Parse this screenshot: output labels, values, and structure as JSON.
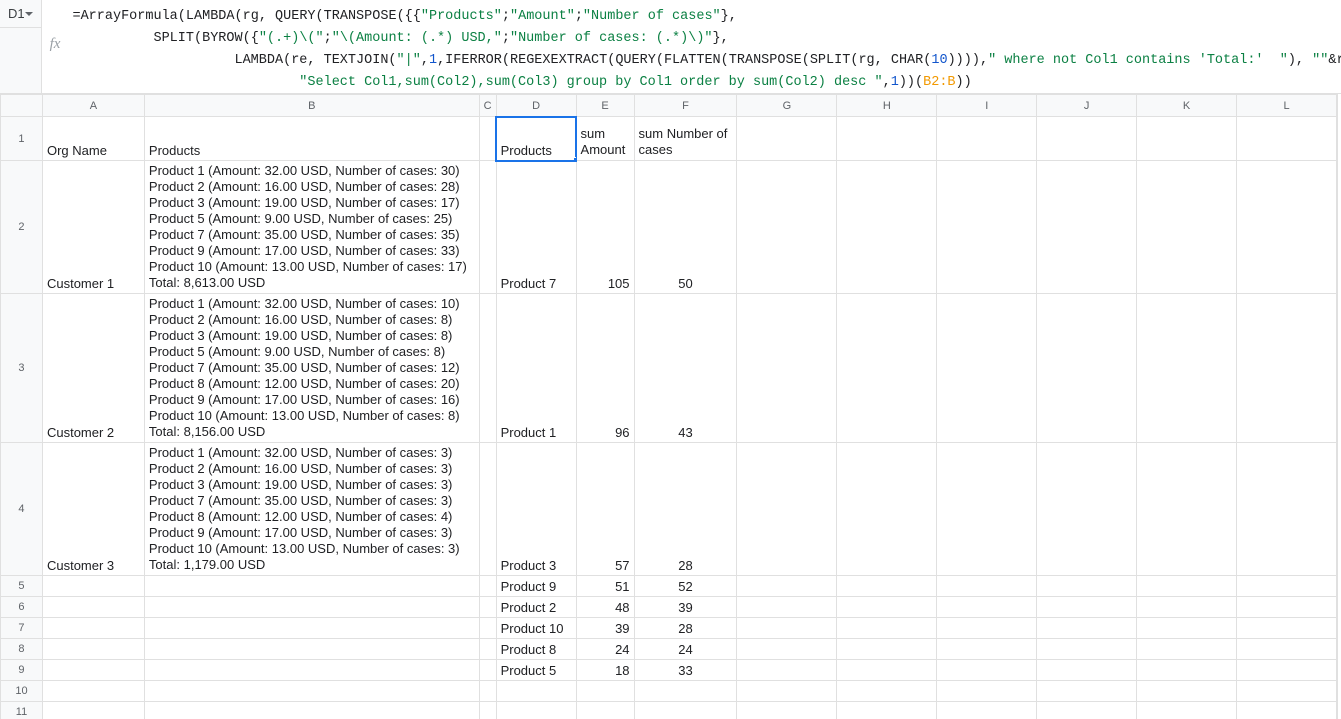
{
  "name_box": {
    "value": "D1"
  },
  "formula": {
    "line1_indent": "",
    "l1_eq": "=",
    "l1_af": "ArrayFormula",
    "l1_p1": "(",
    "l1_lambda": "LAMBDA",
    "l1_p2": "(",
    "l1_rg": "rg",
    "l1_c1": ", ",
    "l1_query": "QUERY",
    "l1_p3": "(",
    "l1_transpose": "TRANSPOSE",
    "l1_p4": "({{",
    "l1_s1": "\"Products\"",
    "l1_sc1": ";",
    "l1_s2": "\"Amount\"",
    "l1_sc2": ";",
    "l1_s3": "\"Number of cases\"",
    "l1_p5": "},",
    "line2_indent": "          ",
    "l2_split": "SPLIT",
    "l2_p1": "(",
    "l2_byrow": "BYROW",
    "l2_p2": "({",
    "l2_s1": "\"(.+)\\(\"",
    "l2_sc1": ";",
    "l2_s2": "\"\\(Amount: (.*) USD,\"",
    "l2_sc2": ";",
    "l2_s3": "\"Number of cases: (.*)\\)\"",
    "l2_p3": "},",
    "line3_indent": "                    ",
    "l3_lambda": "LAMBDA",
    "l3_p1": "(",
    "l3_re": "re",
    "l3_c1": ", ",
    "l3_tj": "TEXTJOIN",
    "l3_p2": "(",
    "l3_s1": "\"|\"",
    "l3_c2": ",",
    "l3_n1": "1",
    "l3_c3": ",",
    "l3_iferr": "IFERROR",
    "l3_p3": "(",
    "l3_regex": "REGEXEXTRACT",
    "l3_p4": "(",
    "l3_query": "QUERY",
    "l3_p5": "(",
    "l3_flat": "FLATTEN",
    "l3_p6": "(",
    "l3_trans": "TRANSPOSE",
    "l3_p7": "(",
    "l3_split": "SPLIT",
    "l3_p8": "(",
    "l3_rg": "rg",
    "l3_c4": ", ",
    "l3_char": "CHAR",
    "l3_p9": "(",
    "l3_n2": "10",
    "l3_p10": ")))),",
    "l3_s2": "\" where not Col1 contains 'Total:'  \"",
    "l3_c5": "), ",
    "l3_s3": "\"\"",
    "l3_amp1": "&",
    "l3_revar": "re",
    "l3_amp2": "&",
    "l3_s4": "\"\"",
    "l3_p11": "))))),",
    "l3_s5": "\"|\"",
    "l3_p12": ")}),",
    "line4_indent": "                            ",
    "l4_s1": "\"Select Col1,sum(Col2),sum(Col3) group by Col1 order by sum(Col2) desc \"",
    "l4_c1": ",",
    "l4_n1": "1",
    "l4_p1": "))(",
    "l4_ref": "B2:B",
    "l4_p2": "))"
  },
  "columns": [
    "A",
    "B",
    "C",
    "D",
    "E",
    "F",
    "G",
    "H",
    "I",
    "J",
    "K",
    "L"
  ],
  "headers": {
    "A": "Org Name",
    "B": "Products",
    "D": "Products",
    "E": "sum Amount",
    "F": "sum Number of cases"
  },
  "rows": [
    {
      "num": "2",
      "A": "Customer 1",
      "B": "Product 1 (Amount: 32.00 USD, Number of cases: 30)\nProduct 2 (Amount: 16.00 USD, Number of cases: 28)\nProduct 3 (Amount: 19.00 USD, Number of cases: 17)\nProduct 5 (Amount: 9.00 USD, Number of cases: 25)\nProduct 7 (Amount: 35.00 USD, Number of cases: 35)\nProduct 9 (Amount: 17.00 USD, Number of cases: 33)\nProduct 10 (Amount: 13.00 USD, Number of cases: 17)\nTotal: 8,613.00 USD",
      "D": "Product 7",
      "E": "105",
      "F": "50",
      "bold": true
    },
    {
      "num": "3",
      "A": "Customer 2",
      "B": "Product 1 (Amount: 32.00 USD, Number of cases: 10)\nProduct 2 (Amount: 16.00 USD, Number of cases: 8)\nProduct 3 (Amount: 19.00 USD, Number of cases: 8)\nProduct 5 (Amount: 9.00 USD, Number of cases: 8)\nProduct 7 (Amount: 35.00 USD, Number of cases: 12)\nProduct 8  (Amount: 12.00 USD, Number of cases: 20)\nProduct 9 (Amount: 17.00 USD, Number of cases: 16)\nProduct 10 (Amount: 13.00 USD, Number of cases: 8)\nTotal: 8,156.00 USD",
      "D": "Product 1",
      "E": "96",
      "F": "43"
    },
    {
      "num": "4",
      "A": "Customer 3",
      "B": "Product 1 (Amount: 32.00 USD, Number of cases: 3)\nProduct 2 (Amount: 16.00 USD, Number of cases: 3)\nProduct 3 (Amount: 19.00 USD, Number of cases: 3)\nProduct 7 (Amount: 35.00 USD, Number of cases: 3)\nProduct 8  (Amount: 12.00 USD, Number of cases: 4)\nProduct 9 (Amount: 17.00 USD, Number of cases: 3)\nProduct 10 (Amount: 13.00 USD, Number of cases: 3)\nTotal: 1,179.00 USD",
      "D": "Product 3",
      "E": "57",
      "F": "28"
    },
    {
      "num": "5",
      "D": "Product 9",
      "E": "51",
      "F": "52"
    },
    {
      "num": "6",
      "D": "Product 2",
      "E": "48",
      "F": "39"
    },
    {
      "num": "7",
      "D": "Product 10",
      "E": "39",
      "F": "28"
    },
    {
      "num": "8",
      "D": "Product 8",
      "E": "24",
      "F": "24"
    },
    {
      "num": "9",
      "D": "Product 5",
      "E": "18",
      "F": "33"
    },
    {
      "num": "10"
    },
    {
      "num": "11"
    }
  ]
}
